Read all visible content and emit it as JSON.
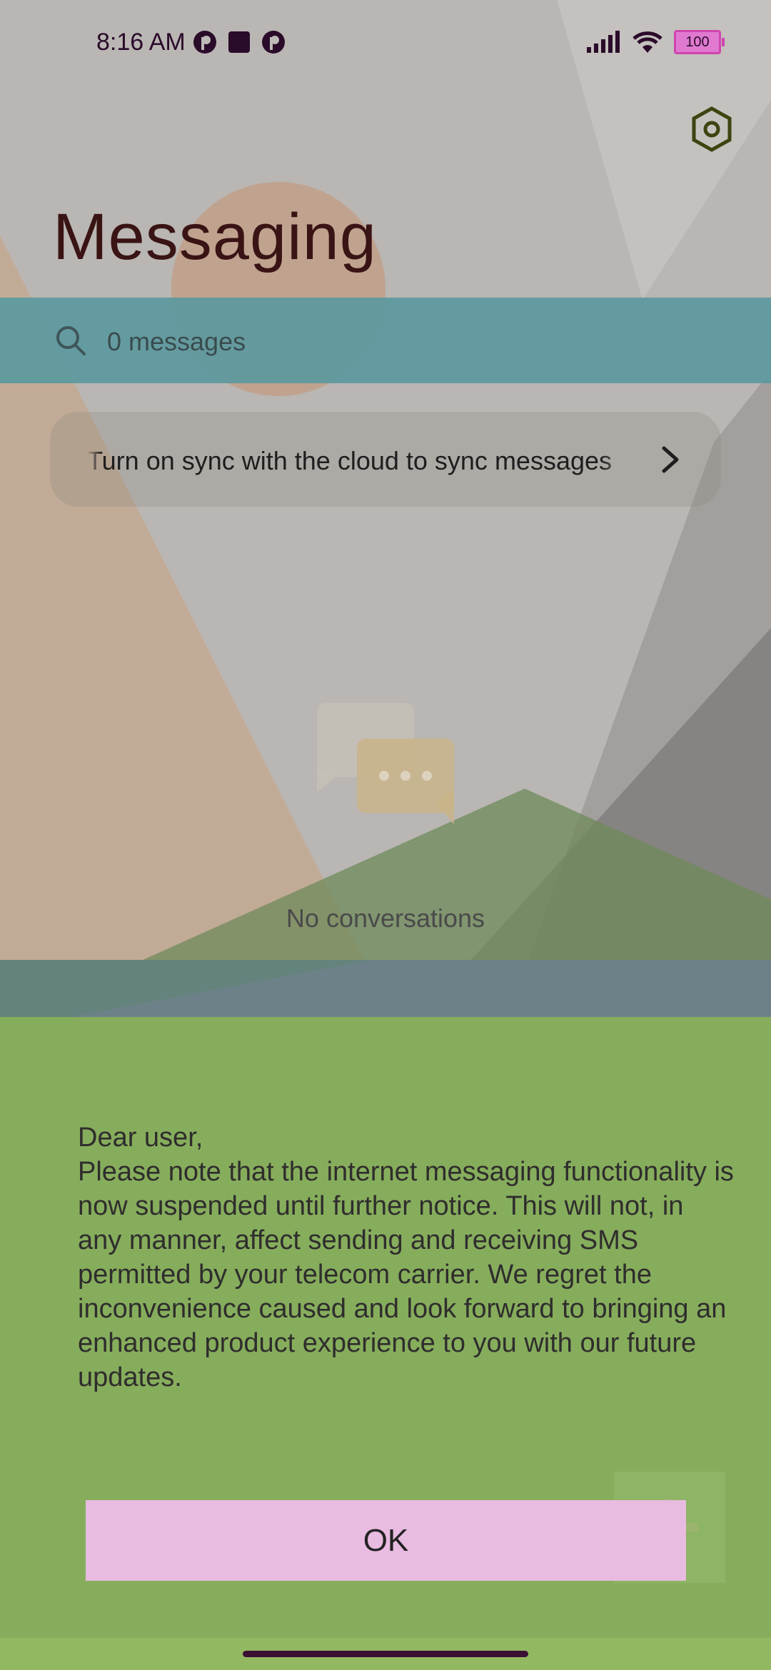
{
  "status_bar": {
    "time": "8:16 AM",
    "battery_level": "100",
    "icons": [
      "pinterest-like-icon",
      "square-icon",
      "pinterest-like-icon",
      "signal-icon",
      "wifi-icon",
      "battery-icon"
    ]
  },
  "header": {
    "title": "Messaging",
    "settings_icon": "gear-icon"
  },
  "search": {
    "text": "0 messages",
    "icon": "search-icon"
  },
  "sync_banner": {
    "text": "Turn on sync with the cloud to sync messages",
    "icon": "chevron-right-icon"
  },
  "empty_state": {
    "icon": "chat-bubbles-icon",
    "text": "No conversations"
  },
  "dialog": {
    "greeting": "Dear user,",
    "message": "Please note that the internet messaging functionality is now suspended until further notice. This will not, in any manner, affect sending and receiving SMS permitted by your telecom carrier. We regret the inconvenience caused and look forward to bringing an enhanced product experience to you with our future updates.",
    "ok_label": "OK"
  },
  "fab": {
    "icon": "plus-icon"
  },
  "colors": {
    "search_bar": "#5f9a9f",
    "dialog_bg": "#86ad5c",
    "ok_button": "#e8bbe0",
    "title": "#3a1414"
  }
}
